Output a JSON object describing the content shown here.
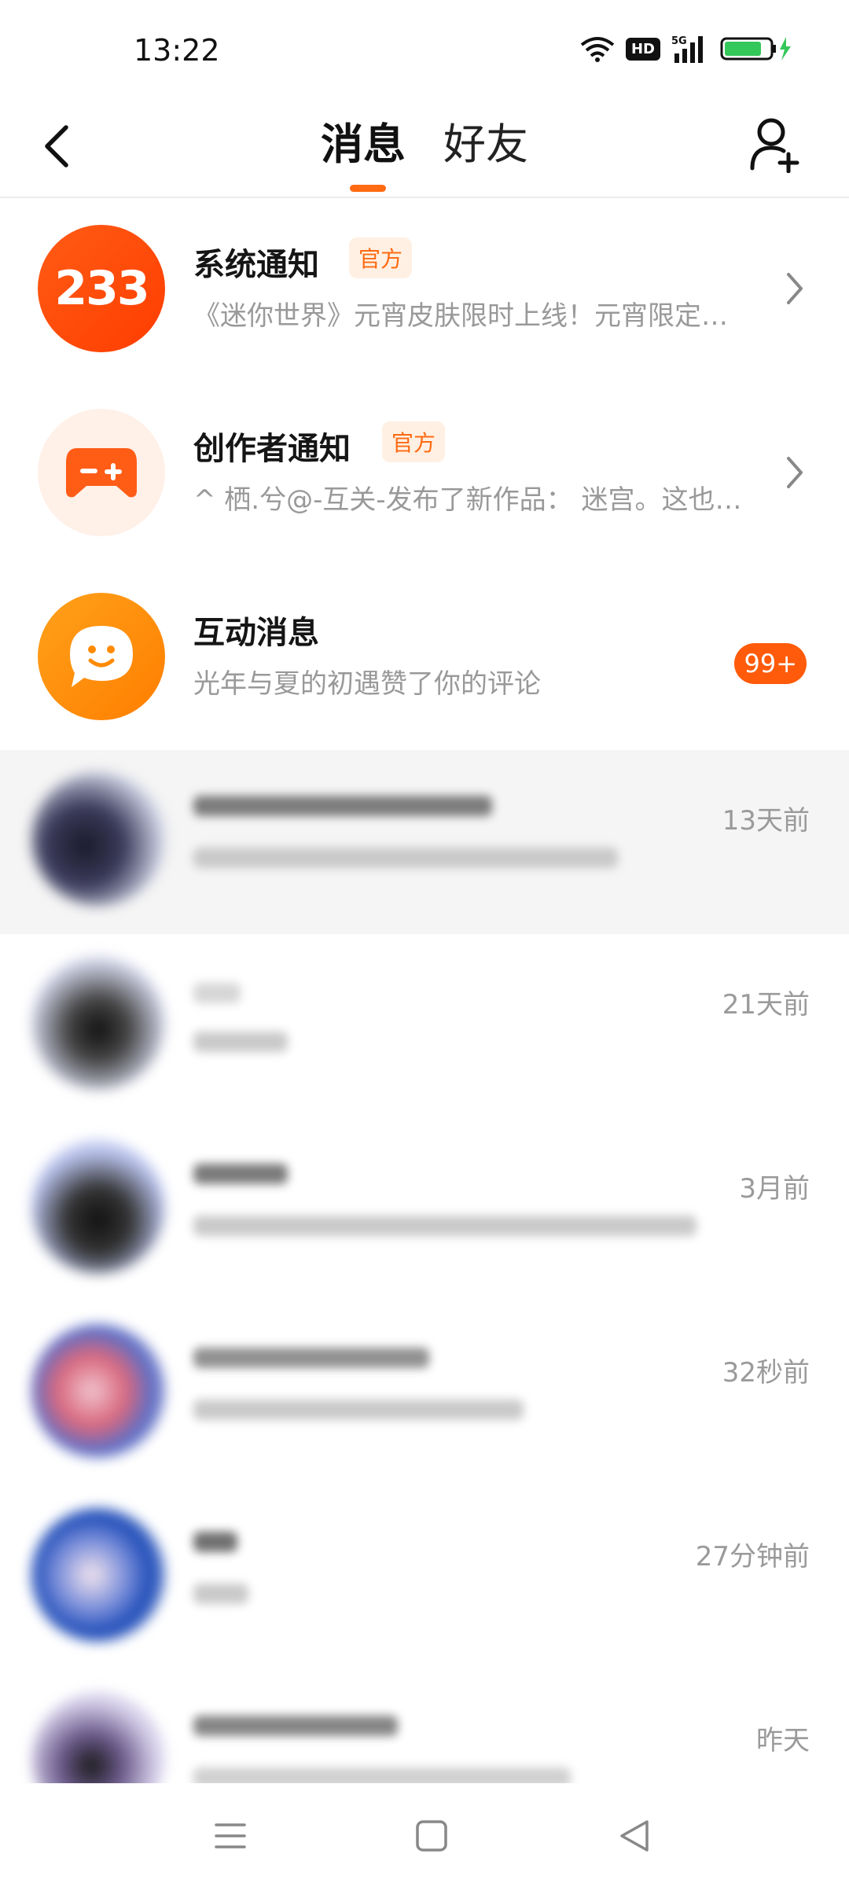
{
  "status_bar": {
    "time": "13:22",
    "network": "5G",
    "hd": "HD",
    "battery_color": "#34c759"
  },
  "header": {
    "tabs": [
      {
        "label": "消息",
        "active": true
      },
      {
        "label": "好友",
        "active": false
      }
    ],
    "accent_color": "#ff6a12"
  },
  "messages": [
    {
      "title": "系统通知",
      "badge": "官方",
      "subtitle": "《迷你世界》元宵皮肤限时上线！元宵限定…",
      "avatar_text": "233",
      "avatar_icon": "brand-233-icon"
    },
    {
      "title": "创作者通知",
      "badge": "官方",
      "subtitle": "^ 栖.兮@-互关-发布了新作品：  迷宫。这也…",
      "avatar_icon": "gamepad-icon"
    },
    {
      "title": "互动消息",
      "subtitle": "光年与夏的初遇赞了你的评论",
      "count": "99+",
      "avatar_icon": "chat-smile-icon"
    }
  ],
  "conversations": [
    {
      "time": "13天前"
    },
    {
      "time": "21天前"
    },
    {
      "time": "3月前"
    },
    {
      "time": "32秒前"
    },
    {
      "time": "27分钟前"
    },
    {
      "time": "昨天"
    }
  ]
}
